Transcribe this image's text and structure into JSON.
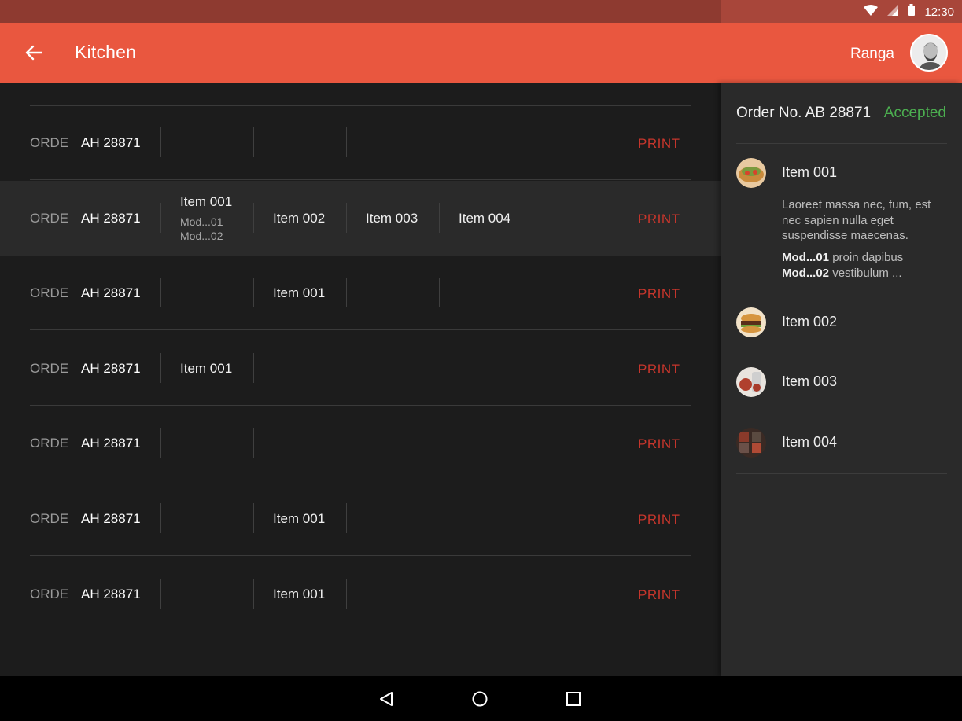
{
  "status_bar": {
    "time": "12:30",
    "icons": [
      "wifi-icon",
      "signal-icon",
      "battery-icon"
    ]
  },
  "app_bar": {
    "title": "Kitchen",
    "back_icon": "arrow-left-icon"
  },
  "user": {
    "name": "Ranga",
    "avatar_icon": "user-avatar"
  },
  "orders": [
    {
      "label": "ORDE",
      "number": "AH 28871",
      "items": [],
      "print": "PRINT",
      "highlighted": false
    },
    {
      "label": "ORDE",
      "number": "AH 28871",
      "items": [
        {
          "name": "Item 001",
          "mods": [
            "Mod...01",
            "Mod...02"
          ]
        },
        {
          "name": "Item 002"
        },
        {
          "name": "Item 003"
        },
        {
          "name": "Item 004"
        }
      ],
      "print": "PRINT",
      "highlighted": true
    },
    {
      "label": "ORDE",
      "number": "AH 28871",
      "items": [
        {
          "name": ""
        },
        {
          "name": "Item 001"
        }
      ],
      "print": "PRINT",
      "highlighted": false
    },
    {
      "label": "ORDE",
      "number": "AH 28871",
      "items": [
        {
          "name": "Item 001"
        }
      ],
      "print": "PRINT",
      "highlighted": false
    },
    {
      "label": "ORDE",
      "number": "AH 28871",
      "items": [],
      "print": "PRINT",
      "highlighted": false
    },
    {
      "label": "ORDE",
      "number": "AH 28871",
      "items": [
        {
          "name": ""
        },
        {
          "name": "Item 001"
        }
      ],
      "print": "PRINT",
      "highlighted": false
    },
    {
      "label": "ORDE",
      "number": "AH 28871",
      "items": [
        {
          "name": ""
        },
        {
          "name": "Item 001"
        }
      ],
      "print": "PRINT",
      "highlighted": false
    }
  ],
  "detail": {
    "order_title": "Order No. AB 28871",
    "status": "Accepted",
    "status_color": "#4caf50",
    "items": [
      {
        "name": "Item 001",
        "thumb": "food-thumb-1"
      },
      {
        "name": "Item 002",
        "thumb": "food-thumb-2"
      },
      {
        "name": "Item 003",
        "thumb": "food-thumb-3"
      },
      {
        "name": "Item 004",
        "thumb": "food-thumb-4"
      }
    ],
    "description": "Laoreet massa nec, fum, est nec sapien nulla eget suspendisse maecenas.",
    "modifiers": [
      {
        "code": "Mod...01",
        "text": "proin dapibus"
      },
      {
        "code": "Mod...02",
        "text": "vestibulum ..."
      }
    ]
  },
  "nav": {
    "back": "nav-back-icon",
    "home": "nav-home-icon",
    "recents": "nav-recents-icon"
  },
  "colors": {
    "accent": "#e9573f",
    "print": "#c8362c",
    "status_bar": "#8e3a30"
  }
}
